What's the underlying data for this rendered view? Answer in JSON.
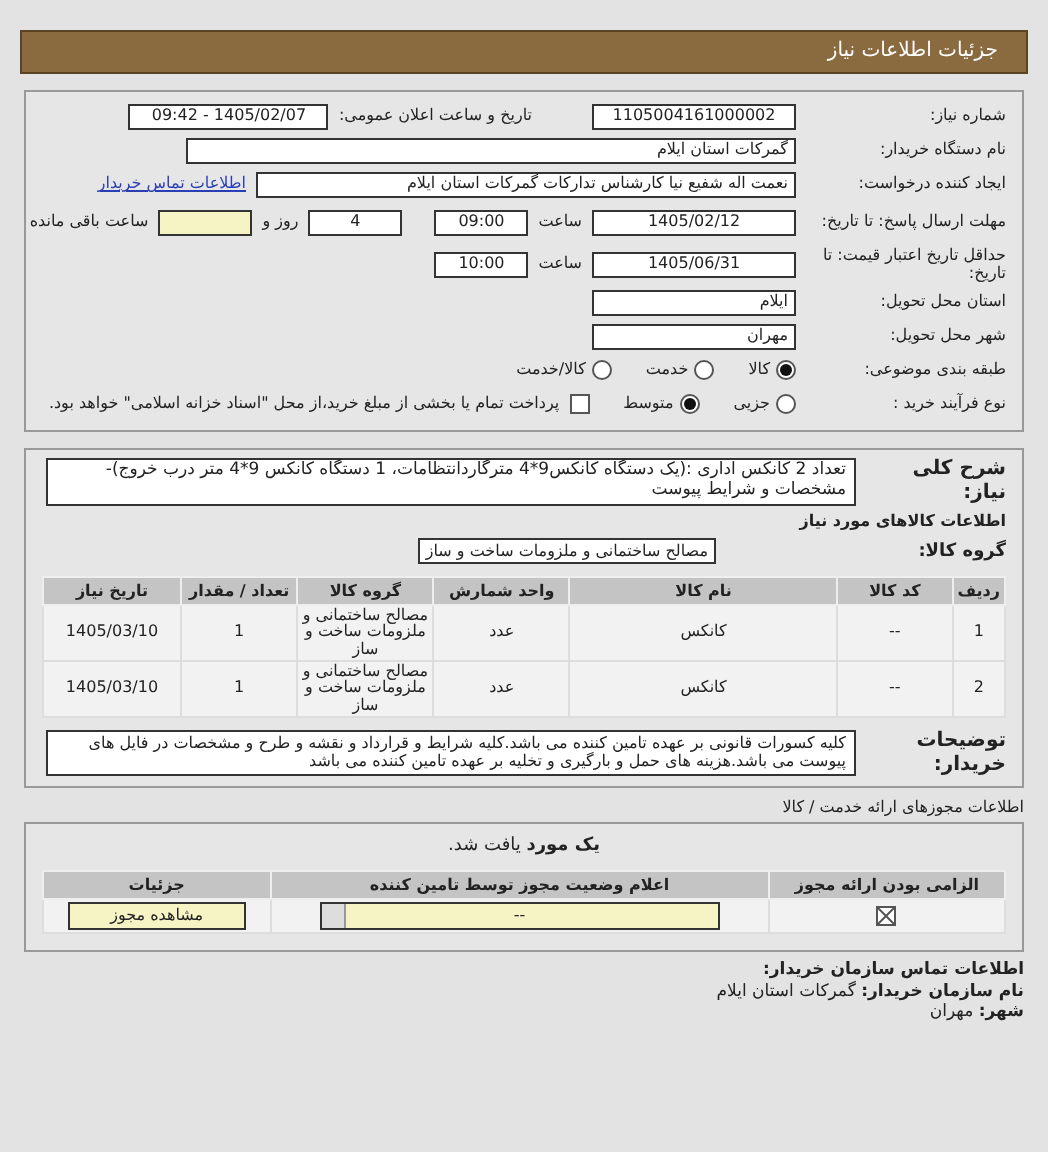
{
  "header": {
    "title": "جزئیات اطلاعات نیاز"
  },
  "need": {
    "number_label": "شماره نیاز:",
    "number": "1105004161000002",
    "announce_label": "تاریخ و ساعت اعلان عمومی:",
    "announce": "1405/02/07 - 09:42",
    "buyer_label": "نام دستگاه خریدار:",
    "buyer": "گمرکات استان ایلام",
    "requester_label": "ایجاد کننده درخواست:",
    "requester": "نعمت اله شفیع نیا کارشناس تدارکات گمرکات استان ایلام",
    "contact_link": "اطلاعات تماس خریدار",
    "deadline_label": "مهلت ارسال پاسخ: تا تاریخ:",
    "deadline_date": "1405/02/12",
    "deadline_time_label": "ساعت",
    "deadline_time": "09:00",
    "days": "4",
    "days_label": "روز و",
    "remaining_label": "ساعت باقی مانده",
    "validity_label": "حداقل تاریخ اعتبار قیمت: تا تاریخ:",
    "validity_date": "1405/06/31",
    "validity_time_label": "ساعت",
    "validity_time": "10:00",
    "province_label": "استان محل تحویل:",
    "province": "ایلام",
    "city_label": "شهر محل تحویل:",
    "city": "مهران",
    "category_label": "طبقه بندی موضوعی:",
    "categories": [
      {
        "label": "کالا",
        "selected": true
      },
      {
        "label": "خدمت",
        "selected": false
      },
      {
        "label": "کالا/خدمت",
        "selected": false
      }
    ],
    "process_label": "نوع فرآیند خرید :",
    "processes": [
      {
        "label": "جزیی",
        "selected": false
      },
      {
        "label": "متوسط",
        "selected": true
      }
    ],
    "treasury": {
      "checked": false,
      "label": "پرداخت تمام یا بخشی از مبلغ خرید،از محل \"اسناد خزانه اسلامی\" خواهد بود."
    }
  },
  "details": {
    "description_label": "شرح کلی نیاز:",
    "description": "تعداد 2 کانکس اداری :(یک دستگاه کانکس9*4 مترگاردانتظامات، 1 دستگاه کانکس 9*4 متر درب خروج)-مشخصات و شرایط پیوست",
    "goods_title": "اطلاعات کالاهای مورد نیاز",
    "group_label": "گروه کالا:",
    "group": "مصالح ساختمانی و ملزومات ساخت و ساز",
    "columns": [
      "ردیف",
      "کد کالا",
      "نام کالا",
      "واحد شمارش",
      "گروه کالا",
      "تعداد / مقدار",
      "تاریخ نیاز"
    ],
    "rows": [
      [
        "1",
        "--",
        "کانکس",
        "عدد",
        "مصالح ساختمانی و ملزومات ساخت و ساز",
        "1",
        "1405/03/10"
      ],
      [
        "2",
        "--",
        "کانکس",
        "عدد",
        "مصالح ساختمانی و ملزومات ساخت و ساز",
        "1",
        "1405/03/10"
      ]
    ],
    "notes_label": "توضیحات خریدار:",
    "notes": "کلیه کسورات قانونی بر عهده تامین کننده می باشد.کلیه شرایط و قرارداد و نقشه و طرح و مشخصات در فایل های پیوست می باشد.هزینه های حمل و بارگیری و تخلیه بر عهده تامین کننده می باشد"
  },
  "licenses": {
    "title": "اطلاعات مجوزهای ارائه خدمت / کالا",
    "found": "**یک مورد** یافت شد.",
    "columns": [
      "الزامی بودن ارائه مجوز",
      "اعلام وضعیت مجوز توسط تامین کننده",
      "جزئیات"
    ],
    "rows": [
      {
        "required": true,
        "status": "--",
        "button": "مشاهده مجوز"
      }
    ]
  },
  "contact": {
    "title": "اطلاعات تماس سازمان خریدار:",
    "org_label": "نام سازمان خریدار:",
    "org": "گمرکات استان ایلام",
    "city_label": "شهر:",
    "city": "مهران"
  }
}
